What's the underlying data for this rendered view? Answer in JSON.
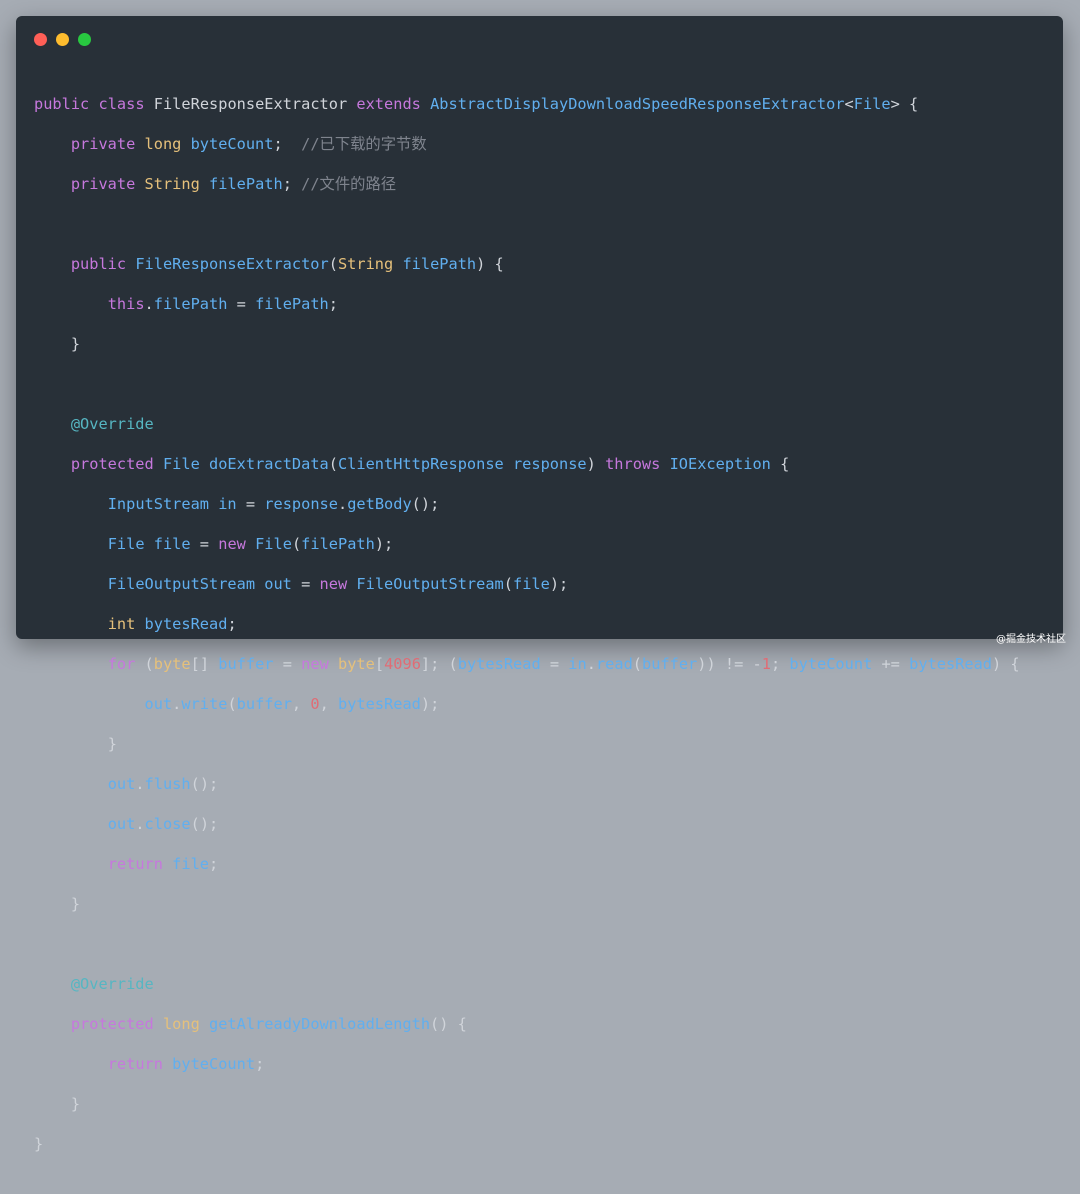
{
  "window": {
    "controls": {
      "close": "close",
      "minimize": "minimize",
      "zoom": "zoom"
    }
  },
  "code": {
    "l1_kw1": "public",
    "l1_kw2": "class",
    "l1_name": "FileResponseExtractor",
    "l1_kw3": "extends",
    "l1_base": "AbstractDisplayDownloadSpeedResponseExtractor",
    "l1_gen": "File",
    "l1_end": "> {",
    "l2_kw": "private",
    "l2_type": "long",
    "l2_var": "byteCount",
    "l2_punct": ";",
    "l2_comment": "//已下载的字节数",
    "l3_kw": "private",
    "l3_type": "String",
    "l3_var": "filePath",
    "l3_punct": ";",
    "l3_comment": "//文件的路径",
    "l5_kw": "public",
    "l5_name": "FileResponseExtractor",
    "l5_open": "(",
    "l5_type": "String",
    "l5_param": "filePath",
    "l5_close": ") {",
    "l6_this": "this",
    "l6_field": "filePath",
    "l6_eq": " = ",
    "l6_val": "filePath",
    "l6_end": ";",
    "l7": "}",
    "l9_ann": "@Override",
    "l10_kw": "protected",
    "l10_type": "File",
    "l10_fn": "doExtractData",
    "l10_open": "(",
    "l10_ptype": "ClientHttpResponse",
    "l10_param": "response",
    "l10_close": ") ",
    "l10_throws": "throws",
    "l10_exc": "IOException",
    "l10_end": " {",
    "l11_type": "InputStream",
    "l11_var": "in",
    "l11_eq": " = ",
    "l11_obj": "response",
    "l11_call": "getBody",
    "l11_end": "();",
    "l12_type": "File",
    "l12_var": "file",
    "l12_eq": " = ",
    "l12_new": "new",
    "l12_ctor": "File",
    "l12_arg": "filePath",
    "l12_end": ");",
    "l13_type": "FileOutputStream",
    "l13_var": "out",
    "l13_eq": " = ",
    "l13_new": "new",
    "l13_ctor": "FileOutputStream",
    "l13_arg": "file",
    "l13_end": ");",
    "l14_type": "int",
    "l14_var": "bytesRead",
    "l14_end": ";",
    "l15_for": "for",
    "l15_type": "byte",
    "l15_br": "[] ",
    "l15_var": "buffer",
    "l15_eq": " = ",
    "l15_new": "new",
    "l15_t2": "byte",
    "l15_num": "4096",
    "l15_a": "]; (",
    "l15_br_var": "bytesRead",
    "l15_eq2": " = ",
    "l15_in": "in",
    "l15_read": "read",
    "l15_buf": "buffer",
    "l15_neq": ")) != -",
    "l15_one": "1",
    "l15_semi": "; ",
    "l15_bc": "byteCount",
    "l15_plus": " += ",
    "l15_br2": "bytesRead",
    "l15_end": ") {",
    "l16_out": "out",
    "l16_write": "write",
    "l16_buf": "buffer",
    "l16_zero": "0",
    "l16_br": "bytesRead",
    "l16_end": ");",
    "l17": "}",
    "l18_out": "out",
    "l18_fn": "flush",
    "l18_end": "();",
    "l19_out": "out",
    "l19_fn": "close",
    "l19_end": "();",
    "l20_ret": "return",
    "l20_var": "file",
    "l20_end": ";",
    "l21": "}",
    "l23_ann": "@Override",
    "l24_kw": "protected",
    "l24_type": "long",
    "l24_fn": "getAlreadyDownloadLength",
    "l24_end": "() {",
    "l25_ret": "return",
    "l25_var": "byteCount",
    "l25_end": ";",
    "l26": "}",
    "l27": "}"
  },
  "watermark": "@掘金技术社区"
}
